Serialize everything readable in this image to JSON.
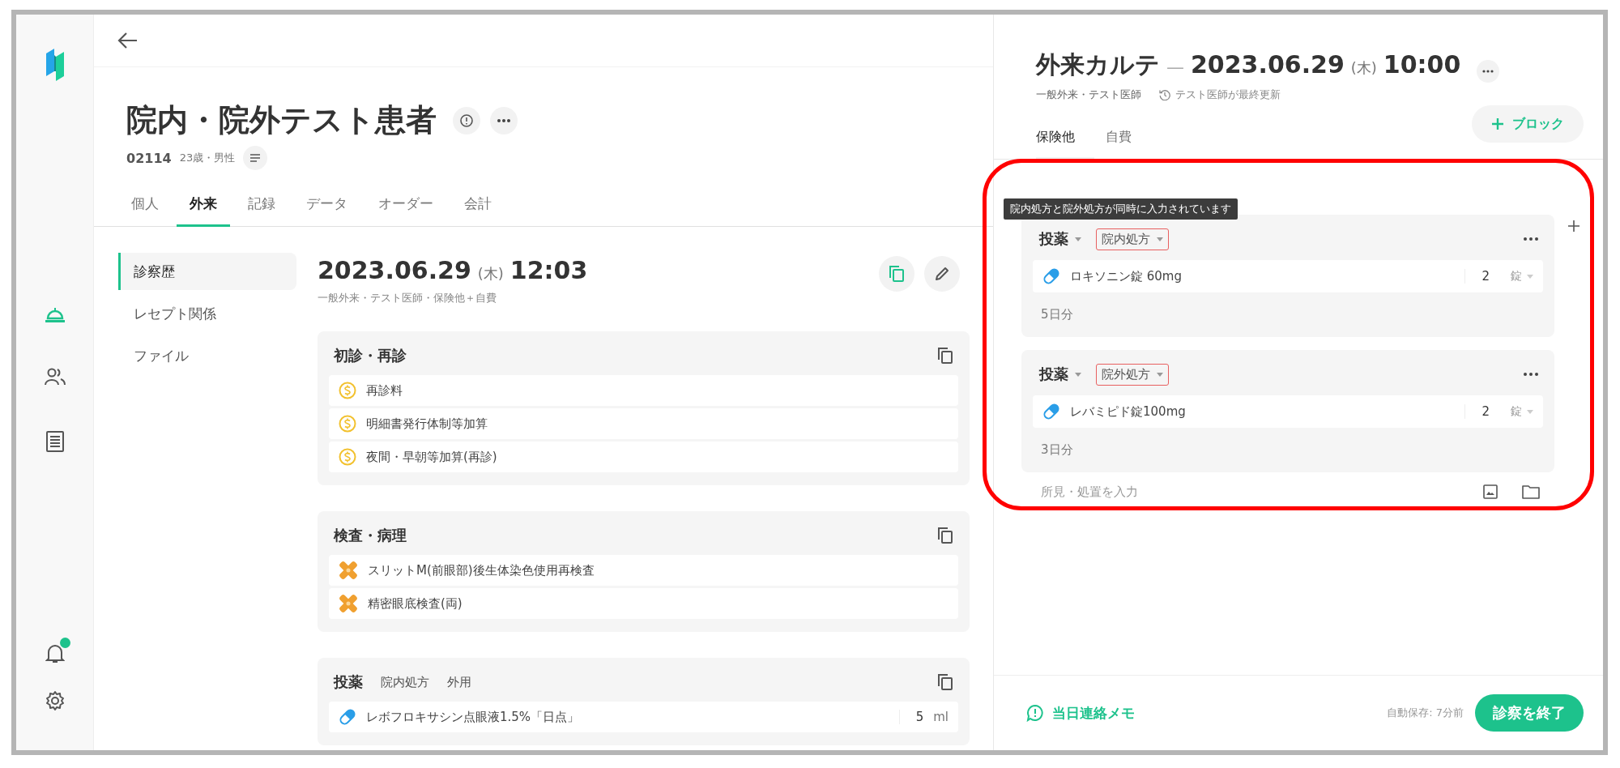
{
  "rail": {
    "items": [
      {
        "kind": "bell",
        "selected": true
      },
      {
        "kind": "people",
        "selected": false
      },
      {
        "kind": "list",
        "selected": false
      }
    ],
    "bottom": [
      {
        "kind": "notification",
        "badge": true
      },
      {
        "kind": "settings"
      }
    ]
  },
  "patient": {
    "name": "院内・院外テスト患者",
    "id": "02114",
    "info": "23歳・男性"
  },
  "tabs": [
    {
      "label": "個人",
      "selected": false
    },
    {
      "label": "外来",
      "selected": true
    },
    {
      "label": "記録",
      "selected": false
    },
    {
      "label": "データ",
      "selected": false
    },
    {
      "label": "オーダー",
      "selected": false
    },
    {
      "label": "会計",
      "selected": false
    }
  ],
  "subnav": [
    {
      "label": "診察歴",
      "selected": true
    },
    {
      "label": "レセプト関係",
      "selected": false
    },
    {
      "label": "ファイル",
      "selected": false
    }
  ],
  "visit": {
    "date": "2023.06.29",
    "weekday": "(木)",
    "time": "12:03",
    "subtitle": "一般外来・テスト医師・保険他＋自費"
  },
  "sections": [
    {
      "title": "初診・再診",
      "items": [
        {
          "kind": "fee",
          "name": "再診料"
        },
        {
          "kind": "fee",
          "name": "明細書発行体制等加算"
        },
        {
          "kind": "fee",
          "name": "夜間・早朝等加算(再診)"
        }
      ]
    },
    {
      "title": "検査・病理",
      "items": [
        {
          "kind": "exam",
          "name": "スリットM(前眼部)後生体染色使用再検査"
        },
        {
          "kind": "exam",
          "name": "精密眼底検査(両)"
        }
      ]
    },
    {
      "title": "投薬",
      "tags": [
        "院内処方",
        "外用"
      ],
      "items": [
        {
          "kind": "drug",
          "name": "レボフロキサシン点眼液1.5%「日点」",
          "qty": "5",
          "unit": "ml"
        }
      ]
    }
  ],
  "chart": {
    "title": "外来カルテ",
    "dash": "—",
    "date": "2023.06.29",
    "weekday": "(木)",
    "time": "10:00",
    "dept": "一般外来・テスト医師",
    "updated": "テスト医師が最終更新",
    "tabs": [
      {
        "label": "保険他",
        "selected": true
      },
      {
        "label": "自費",
        "selected": false
      }
    ],
    "add_button": "ブロック",
    "tooltip": "院内処方と院外処方が同時に入力されています",
    "blocks": [
      {
        "category": "投薬",
        "tag": "院内処方",
        "warning": true,
        "items": [
          {
            "name": "ロキソニン錠 60mg",
            "qty": "2",
            "unit": "錠"
          }
        ],
        "duration": "5日分"
      },
      {
        "category": "投薬",
        "tag": "院外処方",
        "warning": true,
        "items": [
          {
            "name": "レバミピド錠100mg",
            "qty": "2",
            "unit": "錠"
          }
        ],
        "duration": "3日分"
      }
    ],
    "input_placeholder": "所見・処置を入力"
  },
  "footer": {
    "memo": "当日連絡メモ",
    "autosave": "自動保存: 7分前",
    "finish_button": "診察を終了"
  }
}
